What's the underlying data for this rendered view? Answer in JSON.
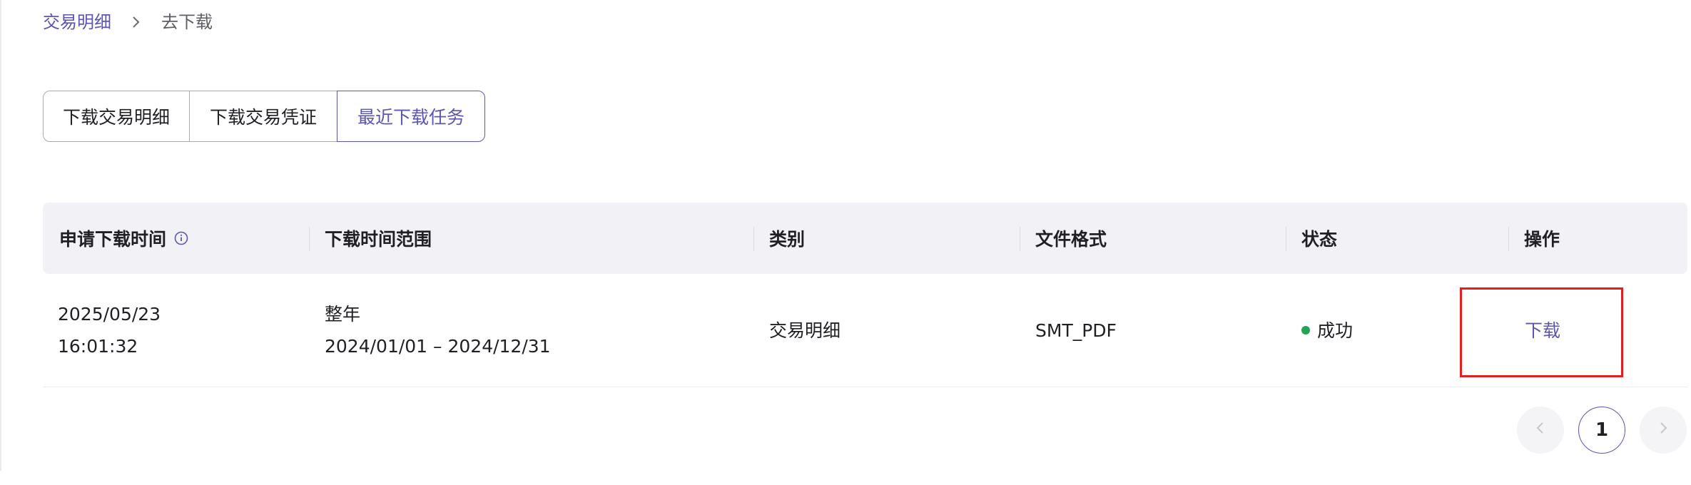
{
  "breadcrumb": {
    "parent": "交易明细",
    "current": "去下载"
  },
  "tabs": [
    {
      "label": "下载交易明细",
      "active": false
    },
    {
      "label": "下载交易凭证",
      "active": false
    },
    {
      "label": "最近下载任务",
      "active": true
    }
  ],
  "table": {
    "headers": {
      "request_time": "申请下载时间",
      "range": "下载时间范围",
      "category": "类别",
      "format": "文件格式",
      "status": "状态",
      "action": "操作"
    },
    "rows": [
      {
        "request_date": "2025/05/23",
        "request_time": "16:01:32",
        "range_type": "整年",
        "range_dates": "2024/01/01 – 2024/12/31",
        "category": "交易明细",
        "format": "SMT_PDF",
        "status": "成功",
        "action": "下载"
      }
    ]
  },
  "pagination": {
    "current_page": "1"
  },
  "colors": {
    "accent": "#5b55b5",
    "success": "#22a454",
    "highlight": "#e02020",
    "header_bg": "#f2f2f6"
  },
  "icons": {
    "breadcrumb_separator": "chevron-right-icon",
    "header_info": "info-icon",
    "prev_page": "chevron-left-icon",
    "next_page": "chevron-right-icon"
  }
}
